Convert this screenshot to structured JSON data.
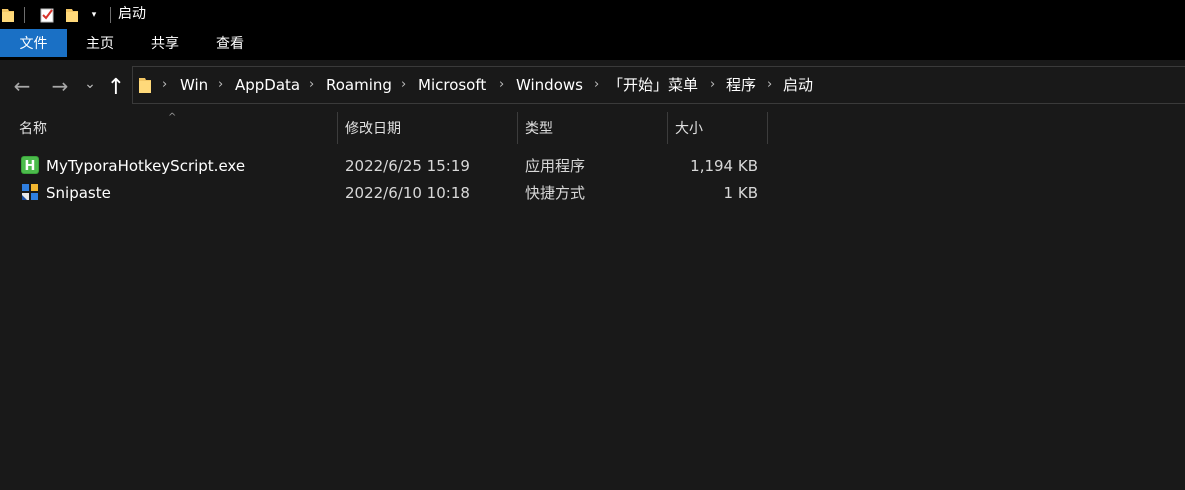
{
  "window": {
    "title": "启动"
  },
  "quick_access": {
    "icons": [
      "folder-icon",
      "properties-icon",
      "new-folder-icon",
      "customize-dropdown-icon"
    ]
  },
  "ribbon": {
    "tabs": [
      {
        "label": "文件",
        "active": true
      },
      {
        "label": "主页",
        "active": false
      },
      {
        "label": "共享",
        "active": false
      },
      {
        "label": "查看",
        "active": false
      }
    ]
  },
  "nav": {
    "back_icon": "←",
    "forward_icon": "→",
    "recent_icon": "⌄",
    "up_icon": "↑",
    "breadcrumbs": [
      "Win",
      "AppData",
      "Roaming",
      "Microsoft",
      "Windows",
      "「开始」菜单",
      "程序",
      "启动"
    ]
  },
  "columns": {
    "name": "名称",
    "date": "修改日期",
    "type": "类型",
    "size": "大小"
  },
  "files": [
    {
      "name": "MyTyporaHotkeyScript.exe",
      "date": "2022/6/25 15:19",
      "type": "应用程序",
      "size": "1,194 KB",
      "icon": "autohotkey-icon"
    },
    {
      "name": "Snipaste",
      "date": "2022/6/10 10:18",
      "type": "快捷方式",
      "size": "1 KB",
      "icon": "snipaste-icon"
    }
  ],
  "colors": {
    "accent": "#1a70c5",
    "background": "#191919",
    "chrome": "#000000"
  }
}
